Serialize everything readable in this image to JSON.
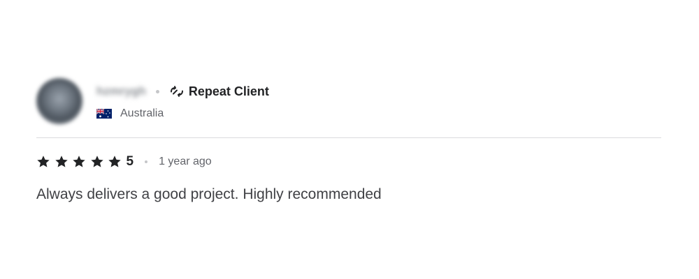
{
  "reviewer": {
    "username": "hzmrygh",
    "badge_label": "Repeat Client",
    "badge_icon": "repeat-icon",
    "country": "Australia",
    "flag_icon": "australia-flag-icon"
  },
  "review": {
    "stars": 5,
    "rating": "5",
    "time_ago": "1 year ago",
    "text": "Always delivers a good project. Highly recommended"
  },
  "colors": {
    "text_primary": "#222325",
    "text_secondary": "#62646a",
    "divider": "#dadbdd"
  }
}
